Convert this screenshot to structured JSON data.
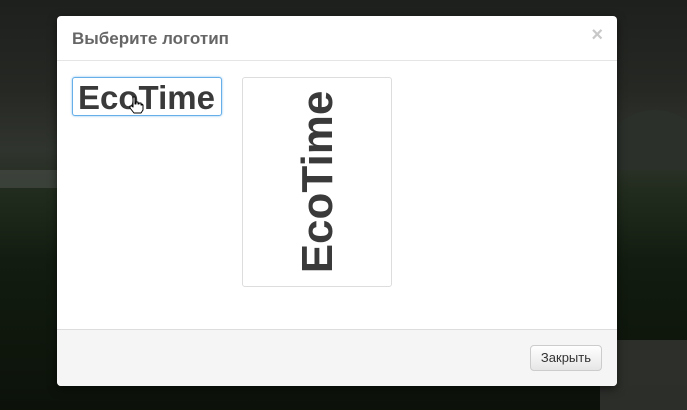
{
  "modal": {
    "title": "Выберите логотип",
    "close_symbol": "×",
    "close_button_label": "Закрыть"
  },
  "logos": [
    {
      "text": "EcoTime",
      "orientation": "horizontal",
      "selected": true
    },
    {
      "text": "EcoTime",
      "orientation": "vertical",
      "selected": false
    }
  ],
  "colors": {
    "selection_border": "#66afe9",
    "logo_text": "#3a3a3a"
  },
  "icons": {
    "close": "close-icon",
    "cursor": "hand-pointer-cursor-icon"
  }
}
